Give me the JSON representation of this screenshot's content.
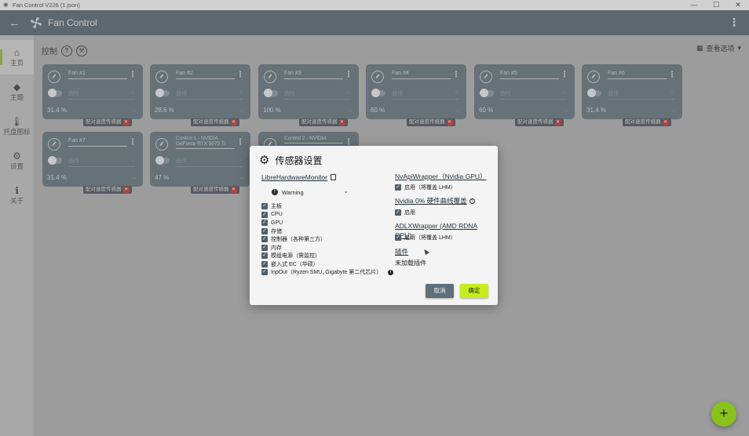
{
  "window": {
    "title": "Fan Control V226 (1.json)",
    "minimize": "—",
    "maximize": "☐",
    "close": "✕"
  },
  "header": {
    "back": "←",
    "title": "Fan Control",
    "more": "⋮"
  },
  "sidebar": {
    "items": [
      {
        "label": "主页",
        "icon": "home-icon",
        "glyph": "⌂"
      },
      {
        "label": "主题",
        "icon": "paint-bucket-icon",
        "glyph": "◆"
      },
      {
        "label": "托盘图标",
        "icon": "thermometer-icon",
        "glyph": "🌡"
      },
      {
        "label": "设置",
        "icon": "gear-icon",
        "glyph": "⚙"
      },
      {
        "label": "关于",
        "icon": "info-icon",
        "glyph": "ℹ"
      }
    ]
  },
  "main": {
    "section_title": "控制",
    "help_glyph": "?",
    "view_options": "查看选项",
    "view_options_dd": "▾"
  },
  "fans": [
    {
      "name": "Fan #1",
      "curve": "曲线",
      "value": "31.4 %",
      "pair": "配对速度传感器"
    },
    {
      "name": "Fan #2",
      "curve": "曲线",
      "value": "28.6 %",
      "pair": "配对速度传感器"
    },
    {
      "name": "Fan #3",
      "curve": "曲线",
      "value": "100 %",
      "pair": "配对速度传感器"
    },
    {
      "name": "Fan #4",
      "curve": "曲线",
      "value": "60 %",
      "pair": "配对速度传感器"
    },
    {
      "name": "Fan #5",
      "curve": "曲线",
      "value": "60 %",
      "pair": "配对速度传感器"
    },
    {
      "name": "Fan #6",
      "curve": "曲线",
      "value": "31.4 %",
      "pair": "配对速度传感器"
    },
    {
      "name": "Fan #7",
      "curve": "曲线",
      "value": "31.4 %",
      "pair": "配对速度传感器"
    },
    {
      "name": "Control 1 - NVIDIA GeForce RTX 5070 Ti",
      "curve": "曲线",
      "value": "47 %",
      "pair": "配对速度传感器"
    },
    {
      "name": "Control 2 - NVIDIA",
      "curve": "",
      "value": "",
      "pair": ""
    }
  ],
  "dialog": {
    "title": "传感器设置",
    "lhm_link": "LibreHardwareMonitor",
    "log_level": "Warning",
    "checkboxes": [
      {
        "label": "主板",
        "checked": true
      },
      {
        "label": "CPU",
        "checked": true
      },
      {
        "label": "GPU",
        "checked": true
      },
      {
        "label": "存储",
        "checked": true
      },
      {
        "label": "控制器（各种第三方）",
        "checked": true
      },
      {
        "label": "内存",
        "checked": true
      },
      {
        "label": "模组电源（需监控）",
        "checked": true
      },
      {
        "label": "嵌入式 EC（华硕）",
        "checked": true
      },
      {
        "label": "InpOut（Ryzen SMU, Gigabyte 第二代芯片）",
        "checked": true
      }
    ],
    "nvapi_link": "NvApiWrapper（Nvidia GPU）",
    "nvapi_enable": "启用（将覆盖 LHM）",
    "nvidia0_link": "Nvidia 0% 硬件曲线覆盖",
    "nvidia0_enable": "启用",
    "adlx_link": "ADLXWrapper (AMD RDNA GPU)",
    "adlx_enable": "启用（将覆盖 LHM）",
    "plugins_link": "插件",
    "plugins_none": "未加载插件",
    "cancel": "取消",
    "ok": "确定"
  },
  "fab": "+",
  "colors": {
    "header": "#4e5f6b",
    "card": "#5c6d79",
    "accent": "#c6ec1e",
    "fab": "#8ac21c"
  }
}
